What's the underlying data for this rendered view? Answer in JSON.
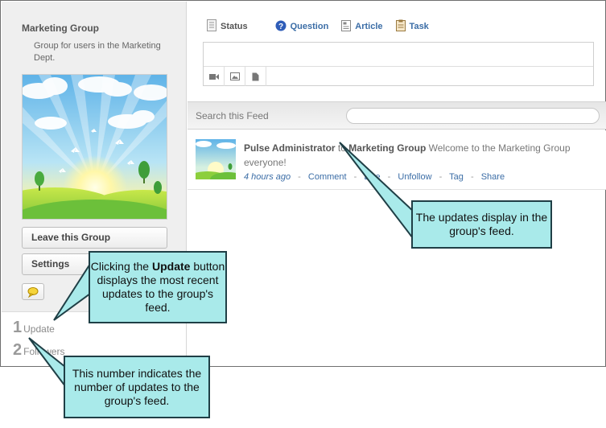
{
  "group": {
    "name": "Marketing Group",
    "description": "Group for users in the Marketing Dept.",
    "leave_label": "Leave this Group",
    "settings_label": "Settings"
  },
  "stats": {
    "updates_count": "1",
    "updates_label": "Update",
    "followers_count": "2",
    "followers_label": "Followers"
  },
  "tabs": {
    "status": "Status",
    "question": "Question",
    "article": "Article",
    "task": "Task"
  },
  "search": {
    "label": "Search this Feed",
    "value": ""
  },
  "feed": {
    "author": "Pulse Administrator",
    "to": "to",
    "target": "Marketing Group",
    "message": "Welcome to the Marketing Group everyone!",
    "time": "4 hours ago",
    "actions": {
      "comment": "Comment",
      "like": "Like",
      "unfollow": "Unfollow",
      "tag": "Tag",
      "share": "Share"
    },
    "separator": "-"
  },
  "callouts": {
    "update_pre": "Clicking the ",
    "update_bold": "Update",
    "update_post": " button displays the most recent updates to the group's feed.",
    "feed": "The updates display in the group's feed.",
    "number": "This number indicates the number of updates to the group's feed."
  },
  "colors": {
    "callout_fill": "#a9eaea",
    "callout_border": "#1f3f46",
    "link_blue": "#3b6da6"
  }
}
